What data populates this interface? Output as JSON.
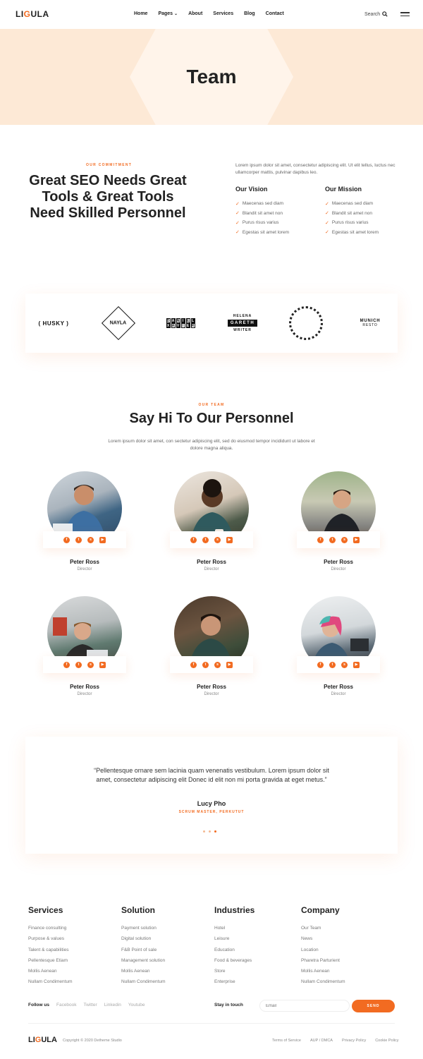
{
  "header": {
    "logo_part1": "LI",
    "logo_part2": "G",
    "logo_part3": "ULA",
    "nav": [
      "Home",
      "Pages",
      "About",
      "Services",
      "Blog",
      "Contact"
    ],
    "search_label": "Search"
  },
  "hero": {
    "title": "Team"
  },
  "commitment": {
    "eyebrow": "Our Commitment",
    "title": "Great SEO Needs Great Tools & Great Tools Need Skilled Personnel",
    "intro": "Lorem ipsum dolor sit amet, consectetur adipiscing elit. Ut elit tellus, luctus nec ullamcorper mattis, pulvinar dapibus leo.",
    "vision": {
      "title": "Our Vision",
      "items": [
        "Maecenas sed diam",
        "Blandit sit amet non",
        "Purus risus varius",
        "Egestas sit amet lorem"
      ]
    },
    "mission": {
      "title": "Our Mission",
      "items": [
        "Maecenas sed diam",
        "Blandit sit amet non",
        "Purus risus varius",
        "Egestas sit amet lorem"
      ]
    }
  },
  "brands": {
    "husky": "( HUSKY )",
    "nayla": "NAYLA",
    "daniel_top": [
      "D",
      "A",
      "N",
      "I",
      "E",
      "L"
    ],
    "daniel_bottom": [
      "X",
      "A",
      "V",
      "I",
      "E",
      "R"
    ],
    "helena_top": "HELENA",
    "helena_mid": "GARETH",
    "helena_bottom": "WRITER",
    "munich_top": "MUNICH",
    "munich_bottom": "RESTO"
  },
  "team": {
    "eyebrow": "Our Team",
    "title": "Say Hi To Our Personnel",
    "intro": "Lorem ipsum dolor sit amet, con sectetur adipiscing elit, sed do eiusmod tempor incididunt ut labore et dolore magna aliqua.",
    "members": [
      {
        "name": "Peter Ross",
        "role": "Director"
      },
      {
        "name": "Peter Ross",
        "role": "Director"
      },
      {
        "name": "Peter Ross",
        "role": "Director"
      },
      {
        "name": "Peter Ross",
        "role": "Director"
      },
      {
        "name": "Peter Ross",
        "role": "Director"
      },
      {
        "name": "Peter Ross",
        "role": "Director"
      }
    ],
    "social_icons": [
      "facebook-icon",
      "twitter-icon",
      "skype-icon",
      "youtube-icon"
    ]
  },
  "testimonial": {
    "quote": "“Pellentesque ornare sem lacinia quam venenatis vestibulum. Lorem ipsum dolor sit amet, consectetur adipiscing elit Donec id elit non mi porta gravida at eget metus.”",
    "name": "Lucy Pho",
    "role": "SCRUM MASTER, PERKUTUT"
  },
  "footer": {
    "columns": [
      {
        "title": "Services",
        "items": [
          "Finance consulting",
          "Purpose & values",
          "Talent & capabilities",
          "Pellentesque Etiam",
          "Mollis Aenean",
          "Nullam Condimentum"
        ]
      },
      {
        "title": "Solution",
        "items": [
          "Payment solution",
          "Digital solution",
          "F&B Point of sale",
          "Management solution",
          "Mollis Aenean",
          "Nullam Condimentum"
        ]
      },
      {
        "title": "Industries",
        "items": [
          "Hotel",
          "Leisure",
          "Education",
          "Food & beverages",
          "Store",
          "Enterprise"
        ]
      },
      {
        "title": "Company",
        "items": [
          "Our Team",
          "News",
          "Location",
          "Pharetra Parturient",
          "Mollis Aenean",
          "Nullam Condimentum"
        ]
      }
    ],
    "follow_label": "Follow us",
    "social_links": [
      "Facebook",
      "Twitter",
      "Linkedin",
      "Youtube"
    ],
    "stay_label": "Stay in touch",
    "email_placeholder": "Email",
    "send_label": "SEND",
    "logo_part1": "LI",
    "logo_part2": "G",
    "logo_part3": "ULA",
    "copyright": "Copyright © 2020 Detheme Studio",
    "legal": [
      "Terms of Service",
      "AUP / DMCA",
      "Privacy Policy",
      "Cookie Policy"
    ]
  },
  "colors": {
    "accent": "#f26b21",
    "hero_bg": "#fde9d6",
    "text": "#222222"
  }
}
